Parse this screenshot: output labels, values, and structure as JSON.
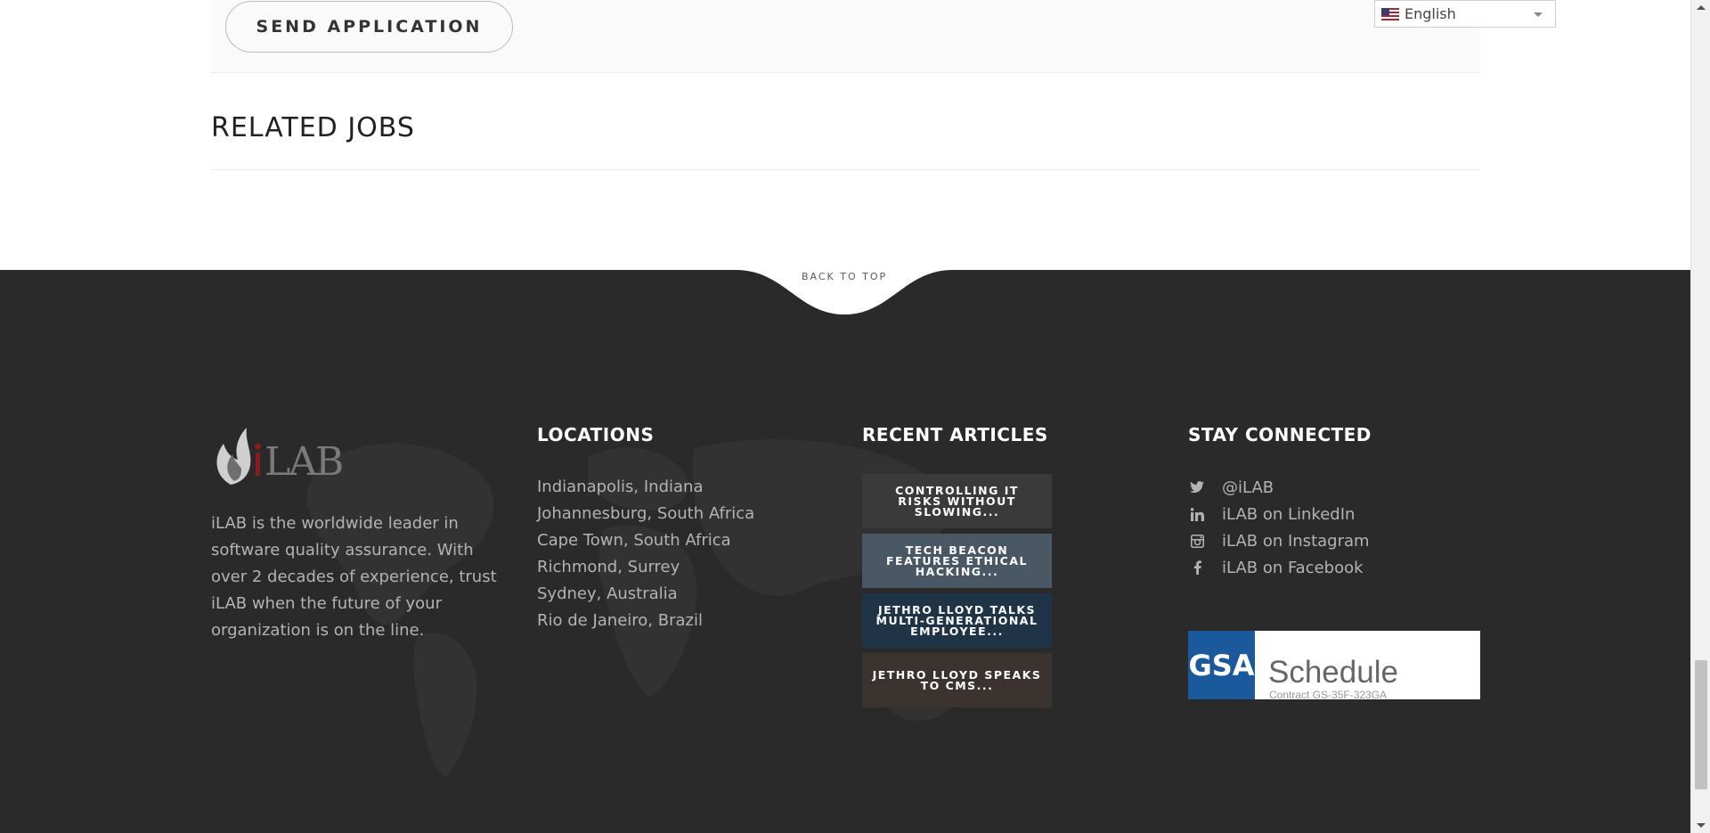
{
  "application": {
    "send_button_label": "SEND APPLICATION"
  },
  "related_jobs": {
    "title": "RELATED JOBS"
  },
  "language_selector": {
    "selected": "English",
    "flag_icon": "us-flag-icon"
  },
  "back_to_top": "BACK TO TOP",
  "footer": {
    "about": {
      "logo_text": "iLAB",
      "text": "iLAB is the worldwide leader in software quality assurance. With over 2 decades of experience, trust iLAB when the future of your organization is on the line."
    },
    "locations": {
      "title": "LOCATIONS",
      "items": [
        "Indianapolis, Indiana",
        "Johannesburg, South Africa",
        "Cape Town, South Africa",
        "Richmond, Surrey",
        "Sydney, Australia",
        "Rio de Janeiro, Brazil"
      ]
    },
    "recent_articles": {
      "title": "RECENT ARTICLES",
      "items": [
        {
          "title": "CONTROLLING IT RISKS WITHOUT SLOWING...",
          "bg": "#3a3a3a"
        },
        {
          "title": "TECH BEACON FEATURES ETHICAL HACKING...",
          "bg": "#4a5866"
        },
        {
          "title": "JETHRO LLOYD TALKS MULTI-GENERATIONAL EMPLOYEE...",
          "bg": "#1f3447"
        },
        {
          "title": "JETHRO LLOYD SPEAKS TO CMS...",
          "bg": "#3b3330"
        }
      ]
    },
    "stay_connected": {
      "title": "STAY CONNECTED",
      "items": [
        {
          "icon": "twitter-icon",
          "label": "@iLAB"
        },
        {
          "icon": "linkedin-icon",
          "label": "iLAB on LinkedIn"
        },
        {
          "icon": "instagram-icon",
          "label": "iLAB on Instagram"
        },
        {
          "icon": "facebook-icon",
          "label": "iLAB on Facebook"
        }
      ],
      "gsa_badge": {
        "logo_text": "GSA",
        "word": "Schedule",
        "contract": "Contract GS-35F-323GA"
      }
    }
  },
  "colors": {
    "footer_bg": "#2a2a2a",
    "footer_text": "#b3b3b3",
    "gsa_blue": "#1a5a9c",
    "logo_red": "#8b1a1a"
  }
}
